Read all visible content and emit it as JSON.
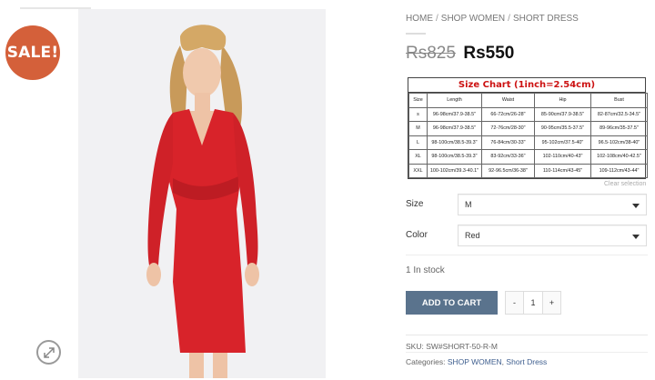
{
  "colors": {
    "sale_badge": "#d4603a",
    "accent_button": "#5a738d",
    "size_chart_title": "#cc1111",
    "link": "#3f5f8f",
    "dress": "#d8232a"
  },
  "gallery": {
    "sale_badge": "SALE!",
    "zoom_icon": "expand-arrows-icon"
  },
  "breadcrumb": {
    "items": [
      "HOME",
      "SHOP WOMEN",
      "SHORT DRESS"
    ],
    "separator": "/"
  },
  "price": {
    "old": "Rs825",
    "new": "Rs550"
  },
  "size_chart": {
    "title": "Size Chart (1inch=2.54cm)",
    "headers": [
      "Size",
      "Length",
      "Waist",
      "Hip",
      "Bust"
    ],
    "rows": [
      [
        "s",
        "96-98cm/37.9-38.5\"",
        "66-72cm/26-28\"",
        "85-90cm/37.9-38.5\"",
        "82-87cm/32.5-34.5\""
      ],
      [
        "M",
        "96-98cm/37.9-38.5\"",
        "72-76cm/28-30\"",
        "90-95cm/35.5-37.5\"",
        "89-96cm/35-37.5\""
      ],
      [
        "L",
        "98-100cm/38.5-39.3\"",
        "76-84cm/30-33\"",
        "95-102cm/37.5-40\"",
        "96.5-102cm/38-40\""
      ],
      [
        "XL",
        "98-100cm/38.5-39.3\"",
        "83-92cm/33-36\"",
        "102-110cm/40-43\"",
        "102-108cm/40-42.5\""
      ],
      [
        "XXL",
        "100-102cm/39.3-40.1\"",
        "92-96.5cm/36-38\"",
        "110-114cm/43-45\"",
        "109-112cm/43-44\""
      ]
    ]
  },
  "clear_selection": "Clear selection",
  "options": {
    "size": {
      "label": "Size",
      "value": "M"
    },
    "color": {
      "label": "Color",
      "value": "Red"
    }
  },
  "stock": "1 In stock",
  "cart": {
    "add_label": "ADD TO CART",
    "minus": "-",
    "quantity": "1",
    "plus": "+"
  },
  "meta": {
    "sku_label": "SKU:",
    "sku": "SW#SHORT-50-R-M",
    "categories_label": "Categories:",
    "categories": [
      "SHOP WOMEN",
      "Short Dress"
    ],
    "categories_sep": ","
  }
}
